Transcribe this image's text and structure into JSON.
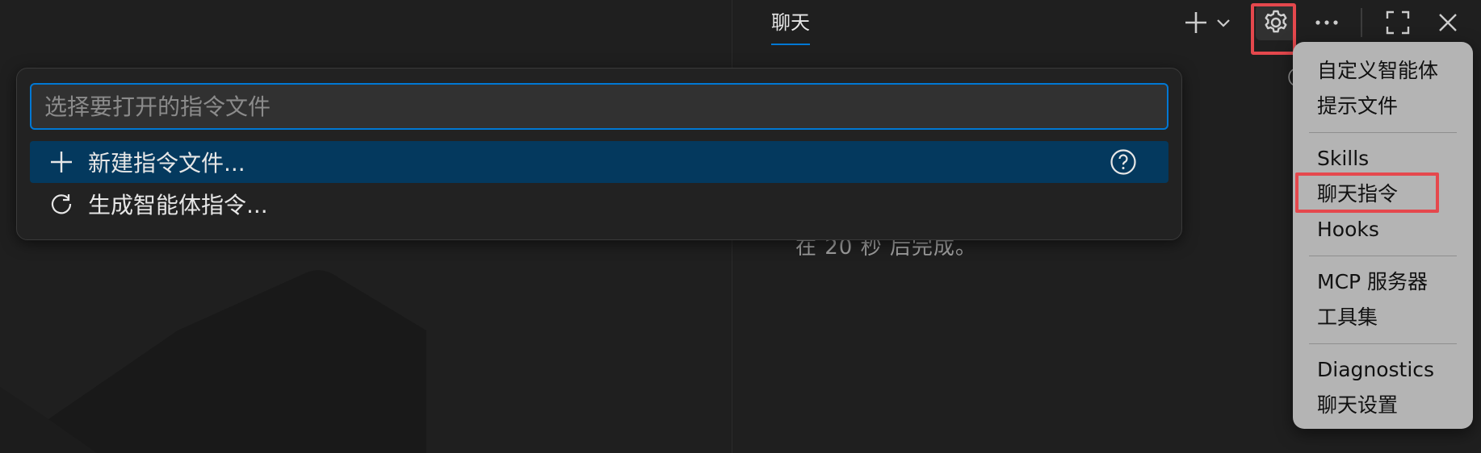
{
  "editor": {
    "watermark_icon": "vscode-logo-watermark"
  },
  "chat_panel": {
    "tab_label": "聊天",
    "toolbar": {
      "new_icon": "plus-icon",
      "new_dropdown_icon": "chevron-down-icon",
      "settings_icon": "gear-icon",
      "more_icon": "ellipsis-icon",
      "maximize_icon": "maximize-icon",
      "close_icon": "close-icon"
    },
    "content_text": "在 20 秒 后完成。"
  },
  "quick_pick": {
    "placeholder": "选择要打开的指令文件",
    "value": "",
    "items": [
      {
        "label": "新建指令文件...",
        "icon": "plus-icon",
        "help_icon": "question-circle-icon",
        "selected": true
      },
      {
        "label": "生成智能体指令...",
        "icon": "refresh-icon",
        "selected": false
      }
    ]
  },
  "context_menu": {
    "groups": [
      [
        "自定义智能体",
        "提示文件"
      ],
      [
        "Skills",
        "聊天指令",
        "Hooks"
      ],
      [
        "MCP 服务器",
        "工具集"
      ],
      [
        "Diagnostics",
        "聊天设置"
      ]
    ],
    "highlighted_item": "聊天指令"
  },
  "colors": {
    "accent": "#0078d4",
    "selection": "#04395e",
    "highlight_box": "#e5484d",
    "menu_bg": "#b4b4b4"
  }
}
